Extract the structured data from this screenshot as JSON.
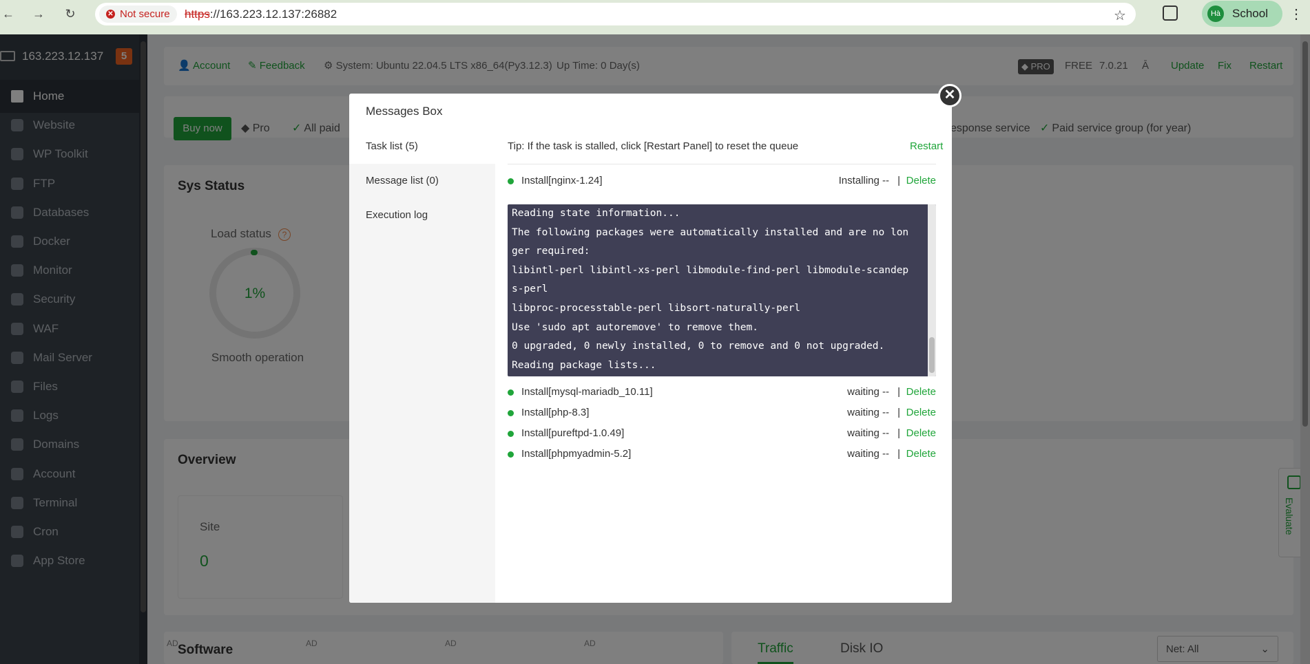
{
  "browser": {
    "security_label": "Not secure",
    "url_scheme": "https",
    "url_rest": "://163.223.12.137:26882",
    "profile_initials": "Hà",
    "profile_name": "School"
  },
  "sidebar": {
    "server_ip": "163.223.12.137",
    "badge": "5",
    "items": [
      {
        "label": "Home",
        "icon": "home-icon"
      },
      {
        "label": "Website",
        "icon": "globe-icon"
      },
      {
        "label": "WP Toolkit",
        "icon": "wordpress-icon"
      },
      {
        "label": "FTP",
        "icon": "ftp-icon"
      },
      {
        "label": "Databases",
        "icon": "database-icon"
      },
      {
        "label": "Docker",
        "icon": "docker-icon"
      },
      {
        "label": "Monitor",
        "icon": "monitor-icon"
      },
      {
        "label": "Security",
        "icon": "shield-icon"
      },
      {
        "label": "WAF",
        "icon": "waf-icon"
      },
      {
        "label": "Mail Server",
        "icon": "mail-icon"
      },
      {
        "label": "Files",
        "icon": "folder-icon"
      },
      {
        "label": "Logs",
        "icon": "logs-icon"
      },
      {
        "label": "Domains",
        "icon": "domains-icon"
      },
      {
        "label": "Account",
        "icon": "user-icon"
      },
      {
        "label": "Terminal",
        "icon": "terminal-icon"
      },
      {
        "label": "Cron",
        "icon": "clock-icon"
      },
      {
        "label": "App Store",
        "icon": "store-icon"
      }
    ]
  },
  "topbar": {
    "account": "Account",
    "feedback": "Feedback",
    "system": "System: Ubuntu 22.04.5 LTS x86_64(Py3.12.3)",
    "uptime": "Up Time: 0 Day(s)",
    "pro": "PRO",
    "free": "FREE",
    "version": "7.0.21",
    "update": "Update",
    "fix": "Fix",
    "restart": "Restart"
  },
  "promo": {
    "buy_now": "Buy now",
    "pro": "Pro",
    "all_paid": "All paid",
    "response_service": "esponse service",
    "paid_group": "Paid service group (for year)"
  },
  "sys_status": {
    "title": "Sys Status",
    "load_label": "Load status",
    "load_value": "1%",
    "load_fraction": 0.01,
    "load_caption": "Smooth operation"
  },
  "overview": {
    "title": "Overview",
    "site_label": "Site",
    "site_value": "0"
  },
  "software": {
    "title": "Software",
    "ad_label": "AD",
    "tabs": [
      "Traffic",
      "Disk IO"
    ],
    "net_select": "Net: All"
  },
  "evaluate": "Evaluate",
  "modal": {
    "title": "Messages Box",
    "tabs": [
      "Task list (5)",
      "Message list (0)",
      "Execution log"
    ],
    "tip": "Tip: If the task is stalled, click [Restart Panel] to reset the queue",
    "restart": "Restart",
    "delete_label": "Delete",
    "separator": "|",
    "active_task": {
      "name": "Install[nginx-1.24]",
      "status": "Installing --"
    },
    "log": "Reading state information...\nThe following packages were automatically installed and are no lon\nger required:\nlibintl-perl libintl-xs-perl libmodule-find-perl libmodule-scandep\ns-perl\nlibproc-processtable-perl libsort-naturally-perl\nUse 'sudo apt autoremove' to remove them.\n0 upgraded, 0 newly installed, 0 to remove and 0 not upgraded.\nReading package lists...",
    "queued_tasks": [
      {
        "name": "Install[mysql-mariadb_10.11]",
        "status": "waiting --"
      },
      {
        "name": "Install[php-8.3]",
        "status": "waiting --"
      },
      {
        "name": "Install[pureftpd-1.0.49]",
        "status": "waiting --"
      },
      {
        "name": "Install[phpmyadmin-5.2]",
        "status": "waiting --"
      }
    ]
  }
}
